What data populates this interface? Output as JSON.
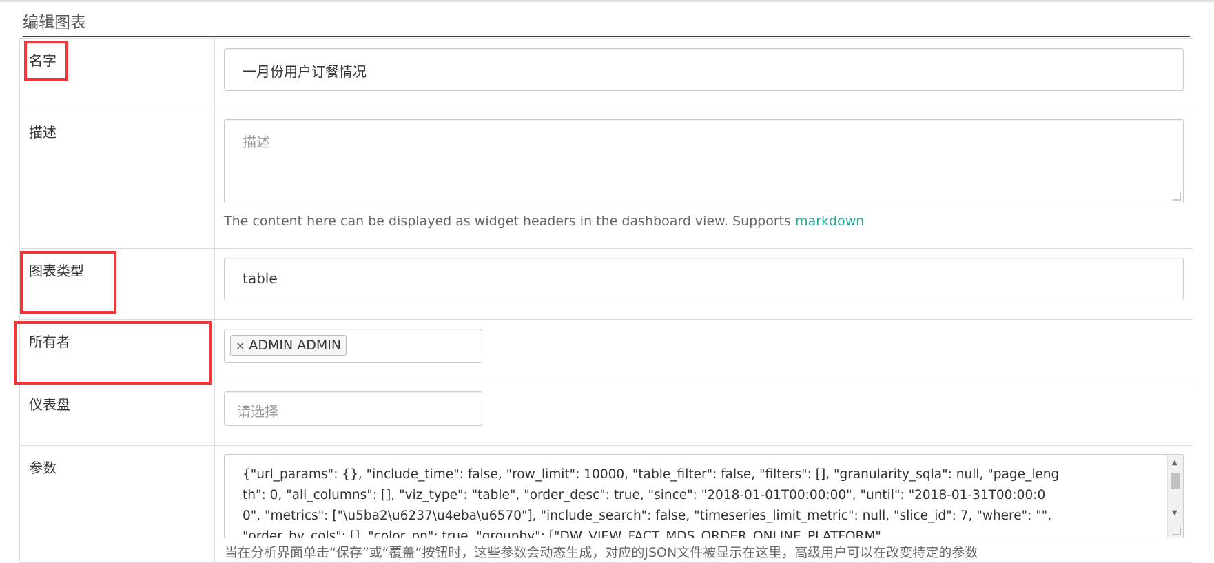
{
  "heading": "编辑图表",
  "fields": {
    "name": {
      "label": "名字",
      "value": "一月份用户订餐情况"
    },
    "description": {
      "label": "描述",
      "placeholder": "描述",
      "help_text": "The content here can be displayed as widget headers in the dashboard view. Supports ",
      "help_link": "markdown"
    },
    "chart_type": {
      "label": "图表类型",
      "value": "table"
    },
    "owners": {
      "label": "所有者",
      "tag": "ADMIN ADMIN",
      "remove_icon": "×"
    },
    "dashboards": {
      "label": "仪表盘",
      "placeholder": "请选择"
    },
    "params": {
      "label": "参数",
      "value": "{\"url_params\": {}, \"include_time\": false, \"row_limit\": 10000, \"table_filter\": false, \"filters\": [], \"granularity_sqla\": null, \"page_length\": 0, \"all_columns\": [], \"viz_type\": \"table\", \"order_desc\": true, \"since\": \"2018-01-01T00:00:00\", \"until\": \"2018-01-31T00:00:00\", \"metrics\": [\"\\u5ba2\\u6237\\u4eba\\u6570\"], \"include_search\": false, \"timeseries_limit_metric\": null, \"slice_id\": 7, \"where\": \"\", \"order_by_cols\": [], \"color_pn\": true, \"groupby\": [\"DW_VIEW_FACT_MDS_ORDER_ONLINE_PLATFORM\"",
      "help_text": "当在分析界面单击“保存”或“覆盖”按钮时，这些参数会动态生成，对应的JSON文件被显示在这里，高级用户可以在改变特定的参数"
    }
  },
  "colors": {
    "highlight": "#f2353b",
    "link": "#26a69a"
  }
}
